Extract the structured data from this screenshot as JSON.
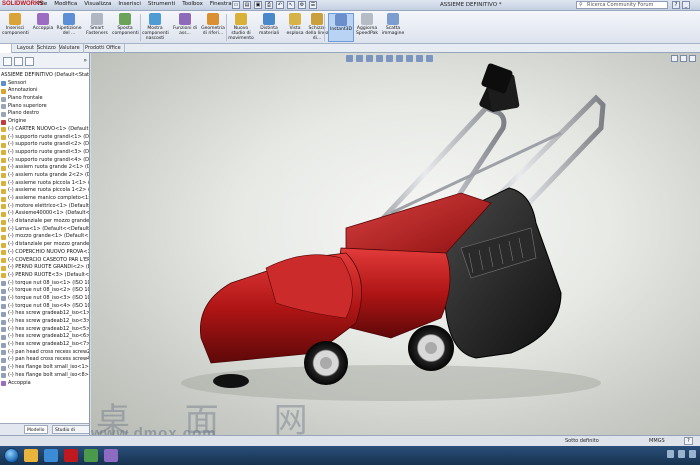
{
  "app": {
    "logo": "SOLIDWORKS",
    "title": "ASSIEME DEFINITIVO *",
    "search_placeholder": "Ricerca Community Forum"
  },
  "menu": [
    "File",
    "Modifica",
    "Visualizza",
    "Inserisci",
    "Strumenti",
    "Toolbox",
    "Finestra"
  ],
  "ribbon": [
    {
      "label": "Inserisci componenti",
      "color": "#d9a33a"
    },
    {
      "label": "Accoppia",
      "color": "#9c6bc2"
    },
    {
      "label": "Ripetizione del ...",
      "color": "#5c8fd6"
    },
    {
      "label": "Smart Fasteners",
      "color": "#b0b7c3"
    },
    {
      "label": "Sposta componenti",
      "color": "#6ba35a"
    },
    {
      "label": "Mostra componenti nascosti",
      "color": "#4f9bd2"
    },
    {
      "label": "Funzioni di ass...",
      "color": "#8e6bb8"
    },
    {
      "label": "Geometria di riferi...",
      "color": "#d98f32"
    },
    {
      "label": "Nuovo studio di movimento",
      "color": "#d9b03a"
    },
    {
      "label": "Distinta materiali",
      "color": "#4a88cc"
    },
    {
      "label": "Vista esplosa",
      "color": "#d6b347"
    },
    {
      "label": "Schizzo della linea di...",
      "color": "#c8a03c"
    },
    {
      "label": "Instant3D",
      "color": "#6b8fcc"
    },
    {
      "label": "Aggiorna SpeedPak",
      "color": "#b6bcc6"
    },
    {
      "label": "Scatta immagine",
      "color": "#7c9ecf"
    }
  ],
  "command_tabs": [
    "Assieme",
    "Layout",
    "Schizzo",
    "Valutare",
    "Prodotti Office"
  ],
  "tree": {
    "root": "ASSIEME DEFINITIVO  (Default<Stato...",
    "items": [
      {
        "label": "Sensori",
        "color": "#5d8fce"
      },
      {
        "label": "Annotazioni",
        "color": "#d8a42e"
      },
      {
        "label": "Piano frontale",
        "color": "#9aa6b7"
      },
      {
        "label": "Piano superiore",
        "color": "#9aa6b7"
      },
      {
        "label": "Piano destro",
        "color": "#9aa6b7"
      },
      {
        "label": "Origine",
        "color": "#c23c3c"
      },
      {
        "label": "(-) CARTER NUOVO<1> (Default<",
        "color": "#d8b13a"
      },
      {
        "label": "(-) supporto ruote grandi<1> (Def",
        "color": "#d8b13a"
      },
      {
        "label": "(-) supporto ruote grandi<2> (Def",
        "color": "#d8b13a"
      },
      {
        "label": "(-) supporto ruote grandi<3> (Def",
        "color": "#d8b13a"
      },
      {
        "label": "(-) supporto ruote grandi<4> (Def",
        "color": "#d8b13a"
      },
      {
        "label": "(-) assiem ruota grande 2<1> (Def",
        "color": "#d8b13a"
      },
      {
        "label": "(-) assiem ruota grande 2<2> (Def",
        "color": "#d8b13a"
      },
      {
        "label": "(-) assieme ruota piccola 1<1> (De",
        "color": "#d8b13a"
      },
      {
        "label": "(-) assieme ruota piccola 1<2> (De",
        "color": "#d8b13a"
      },
      {
        "label": "(-) assieme manico completo<1>",
        "color": "#d8b13a"
      },
      {
        "label": "(-) motore elettrico<1> (Default",
        "color": "#d8b13a"
      },
      {
        "label": "(-) Assieme40000<1> (Default<Sta",
        "color": "#d8b13a"
      },
      {
        "label": "(-) distanziale per mozzo grande<",
        "color": "#d8b13a"
      },
      {
        "label": "(-) Lama<1> (Default<<Default>_",
        "color": "#d8b13a"
      },
      {
        "label": "(-) mozzo grande<1> (Default<<D",
        "color": "#d8b13a"
      },
      {
        "label": "(-) distanziale per mozzo grande<",
        "color": "#d8b13a"
      },
      {
        "label": "(-) COPERCHIO NUOVO PROVA<1>",
        "color": "#d8b13a"
      },
      {
        "label": "(-) COVERCIO CASEOTO PAR L'ER",
        "color": "#d8b13a"
      },
      {
        "label": "(-) PERNO RUOTE GRANDI<2> (De",
        "color": "#d8b13a"
      },
      {
        "label": "(-) PERNO RUOTE<3> (Default<<D",
        "color": "#d8b13a"
      },
      {
        "label": "(-) torque nut 08_iso<1> (ISO 1051",
        "color": "#8fa0b8"
      },
      {
        "label": "(-) torque nut 08_iso<2> (ISO 1051",
        "color": "#8fa0b8"
      },
      {
        "label": "(-) torque nut 08_iso<3> (ISO 1051",
        "color": "#8fa0b8"
      },
      {
        "label": "(-) torque nut 08_iso<4> (ISO 1051",
        "color": "#8fa0b8"
      },
      {
        "label": "(-) hex screw gradeab12_iso<1> (I",
        "color": "#8fa0b8"
      },
      {
        "label": "(-) hex screw gradeab12_iso<3> (I",
        "color": "#8fa0b8"
      },
      {
        "label": "(-) hex screw gradeab12_iso<5> (I",
        "color": "#8fa0b8"
      },
      {
        "label": "(-) hex screw gradeab12_iso<6> (I",
        "color": "#8fa0b8"
      },
      {
        "label": "(-) hex screw gradeab12_iso<7> (I",
        "color": "#8fa0b8"
      },
      {
        "label": "(-) pan head cross recess screw2_is",
        "color": "#8fa0b8"
      },
      {
        "label": "(-) pan head cross recess screw4-R",
        "color": "#8fa0b8"
      },
      {
        "label": "(-) hex flange bolt small_iso<1> (I",
        "color": "#8fa0b8"
      },
      {
        "label": "(-) hex flange bolt small_iso<8> (I",
        "color": "#8fa0b8"
      }
    ],
    "last": "Accoppia"
  },
  "bottom_tabs": [
    "Modello",
    "Studio di movimento 1"
  ],
  "status": {
    "text": "Sotto definito",
    "units": "MMGS"
  },
  "watermark": {
    "chars": "桌 面 网",
    "url": "www.dmox.com"
  }
}
